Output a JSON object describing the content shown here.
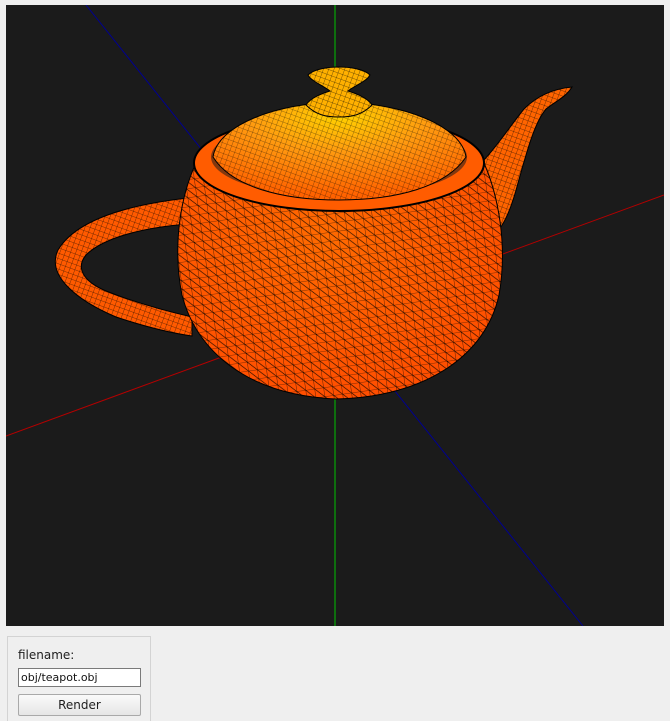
{
  "viewport": {
    "background": "#1b1b1b",
    "axes": {
      "x_axis_color": "#b40000",
      "y_axis_color": "#00c000",
      "z_axis_color": "#000090"
    },
    "model": {
      "name": "teapot",
      "body_color": "#ff5400",
      "highlight_color": "#ffd400",
      "wire_color": "#000000"
    }
  },
  "controls": {
    "filename_label": "filename:",
    "filename_value": "obj/teapot.obj",
    "render_label": "Render"
  }
}
